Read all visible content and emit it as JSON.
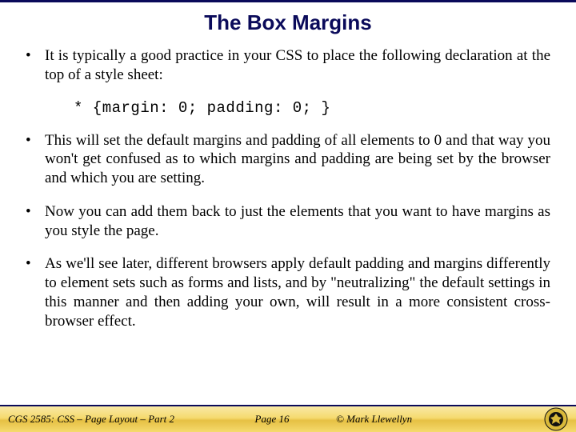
{
  "title": "The Box Margins",
  "bullets": [
    "It is typically a good practice in your CSS to place the following declaration at the top of a style sheet:",
    "This will set the default margins and padding of all elements to 0 and that way you won't get confused as to which margins and padding are being set by the browser and which you are setting.",
    "Now you can add them back to just the elements that you want to have margins as you style the page.",
    "As we'll see later, different browsers apply default padding and margins differently to element sets such as forms and lists, and by \"neutralizing\" the default settings in this manner and then adding your own, will result in a more consistent cross-browser effect."
  ],
  "code": "* {margin: 0;  padding: 0; }",
  "footer": {
    "course": "CGS 2585: CSS – Page Layout – Part 2",
    "page": "Page 16",
    "author": "© Mark Llewellyn"
  }
}
